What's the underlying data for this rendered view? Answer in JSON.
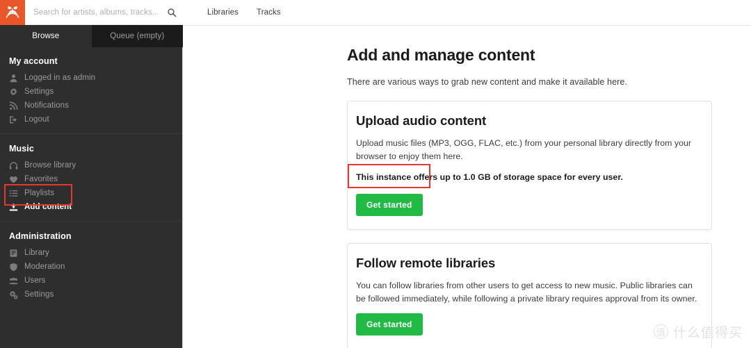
{
  "brand": {
    "logo_icon": "funkwhale-logo",
    "logo_color": "#e8562a"
  },
  "search": {
    "placeholder": "Search for artists, albums, tracks...",
    "value": "",
    "icon": "search-icon"
  },
  "tabs": [
    {
      "label": "Browse",
      "active": true
    },
    {
      "label": "Queue (empty)",
      "active": false
    }
  ],
  "sidebar": {
    "sections": [
      {
        "title": "My account",
        "items": [
          {
            "label": "Logged in as admin",
            "icon": "user-icon",
            "active": false
          },
          {
            "label": "Settings",
            "icon": "gear-icon",
            "active": false
          },
          {
            "label": "Notifications",
            "icon": "rss-icon",
            "active": false
          },
          {
            "label": "Logout",
            "icon": "logout-icon",
            "active": false
          }
        ]
      },
      {
        "title": "Music",
        "items": [
          {
            "label": "Browse library",
            "icon": "headphones-icon",
            "active": false
          },
          {
            "label": "Favorites",
            "icon": "heart-icon",
            "active": false
          },
          {
            "label": "Playlists",
            "icon": "list-icon",
            "active": false
          },
          {
            "label": "Add content",
            "icon": "upload-icon",
            "active": true
          }
        ]
      },
      {
        "title": "Administration",
        "items": [
          {
            "label": "Library",
            "icon": "book-icon",
            "active": false
          },
          {
            "label": "Moderation",
            "icon": "shield-icon",
            "active": false
          },
          {
            "label": "Users",
            "icon": "users-icon",
            "active": false
          },
          {
            "label": "Settings",
            "icon": "gears-icon",
            "active": false
          }
        ]
      }
    ]
  },
  "topbar": {
    "links": [
      {
        "label": "Libraries"
      },
      {
        "label": "Tracks"
      }
    ]
  },
  "main": {
    "title": "Add and manage content",
    "subtitle": "There are various ways to grab new content and make it available here.",
    "cards": [
      {
        "title": "Upload audio content",
        "text": "Upload music files (MP3, OGG, FLAC, etc.) from your personal library directly from your browser to enjoy them here.",
        "emphasis": "This instance offers up to 1.0 GB of storage space for every user.",
        "button": "Get started"
      },
      {
        "title": "Follow remote libraries",
        "text": "You can follow libraries from other users to get access to new music. Public libraries can be followed immediately, while following a private library requires approval from its owner.",
        "emphasis": "",
        "button": "Get started"
      }
    ]
  },
  "annotations": {
    "color": "#e8372c",
    "boxes": [
      {
        "target": "Add content"
      },
      {
        "target": "Get started"
      }
    ]
  },
  "watermark": {
    "mark": "值",
    "text": "什么值得买"
  },
  "colors": {
    "accent_orange": "#e8562a",
    "green_button": "#21ba45",
    "sidebar_bg": "#2e2e2e",
    "queue_tab_bg": "#1b1b1b",
    "annotation_red": "#e8372c"
  }
}
